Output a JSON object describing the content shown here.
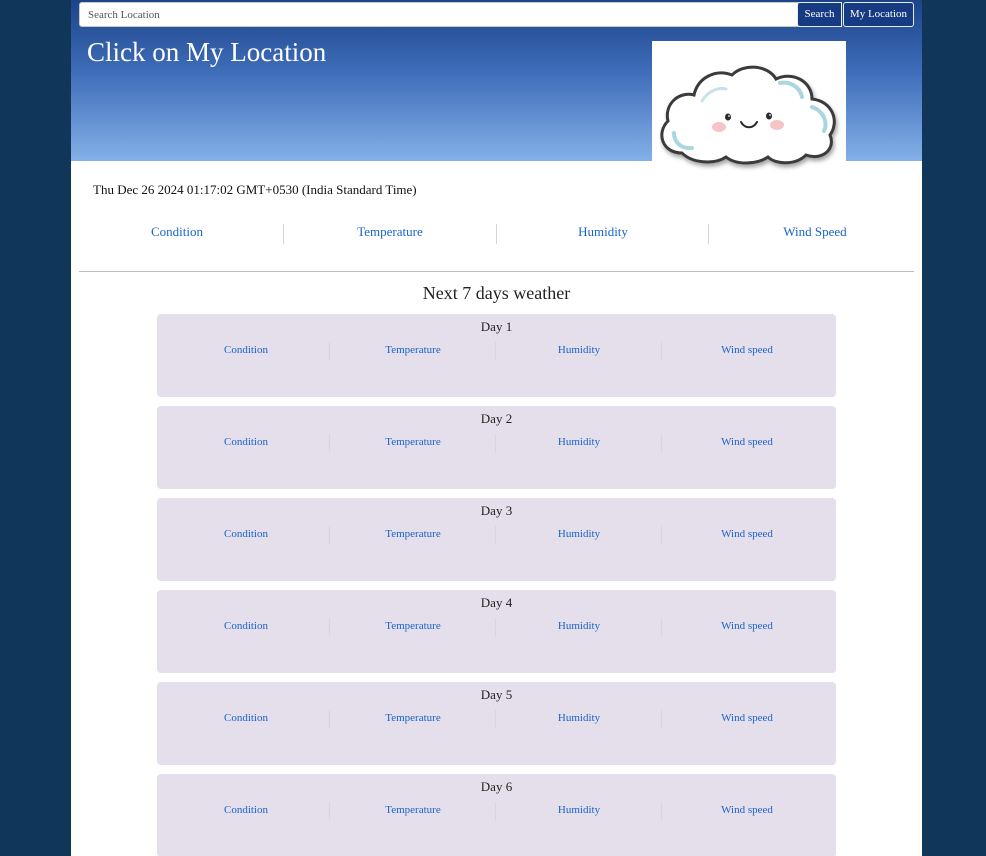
{
  "search": {
    "placeholder": "Search Location",
    "search_label": "Search",
    "location_label": "My Location"
  },
  "hero": {
    "title": "Click on My Location",
    "image_icon": "smiling-cloud-icon"
  },
  "current": {
    "datetime": "Thu Dec 26 2024 01:17:02 GMT+0530 (India Standard Time)",
    "metrics": [
      "Condition",
      "Temperature",
      "Humidity",
      "Wind Speed"
    ]
  },
  "forecast": {
    "title": "Next 7 days weather",
    "fields": [
      "Condition",
      "Temperature",
      "Humidity",
      "Wind speed"
    ],
    "days": [
      "Day 1",
      "Day 2",
      "Day 3",
      "Day 4",
      "Day 5",
      "Day 6"
    ]
  },
  "colors": {
    "background": "#10375a",
    "hero_top": "#1c4489",
    "hero_bottom": "#84b0e8",
    "button": "#163b82",
    "link": "#1a63c9",
    "card": "#e4dfea"
  }
}
